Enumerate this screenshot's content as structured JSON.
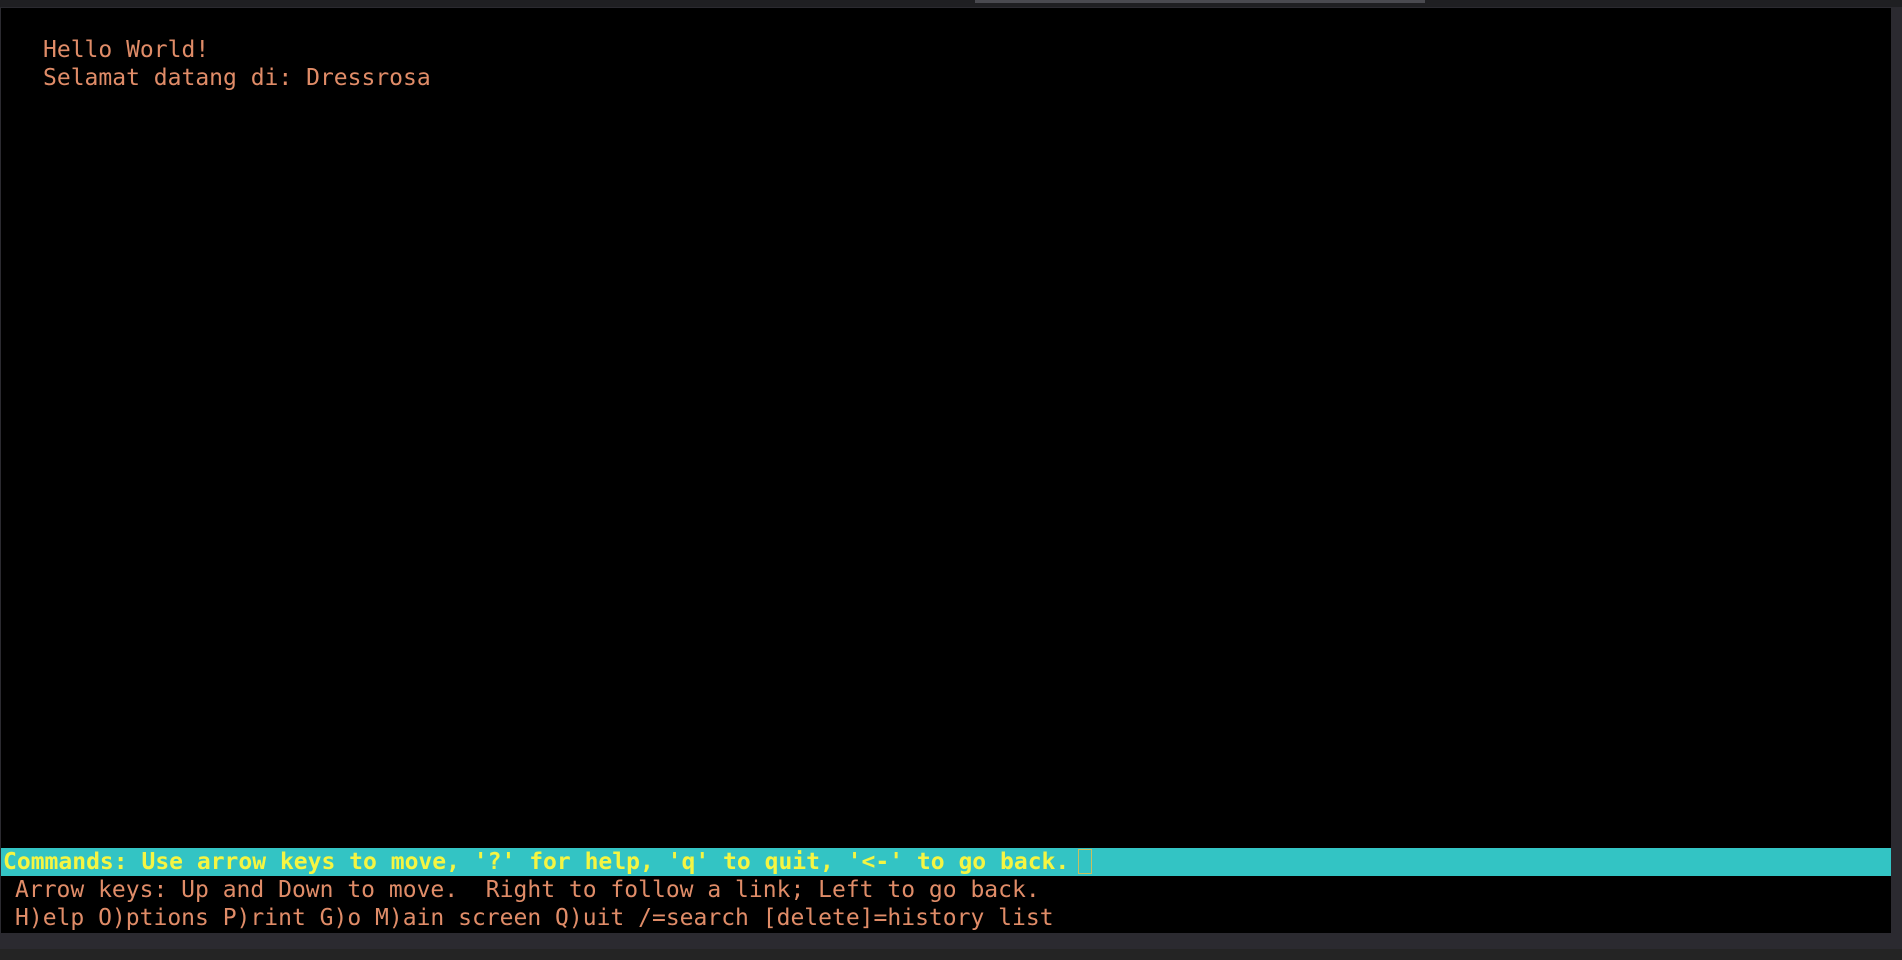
{
  "terminal": {
    "content": {
      "line1": "Hello World!",
      "line2": "Selamat datang di: Dressrosa"
    },
    "status_bar": {
      "text": "Commands: Use arrow keys to move, '?' for help, 'q' to quit, '<-' to go back."
    },
    "help": {
      "line1": "Arrow keys: Up and Down to move.  Right to follow a link; Left to go back.",
      "line2": "H)elp O)ptions P)rint G)o M)ain screen Q)uit /=search [delete]=history list"
    }
  },
  "colors": {
    "background": "#000000",
    "text": "#e08c68",
    "status_bar_bg": "#33c4c4",
    "status_bar_text": "#f5f542"
  }
}
